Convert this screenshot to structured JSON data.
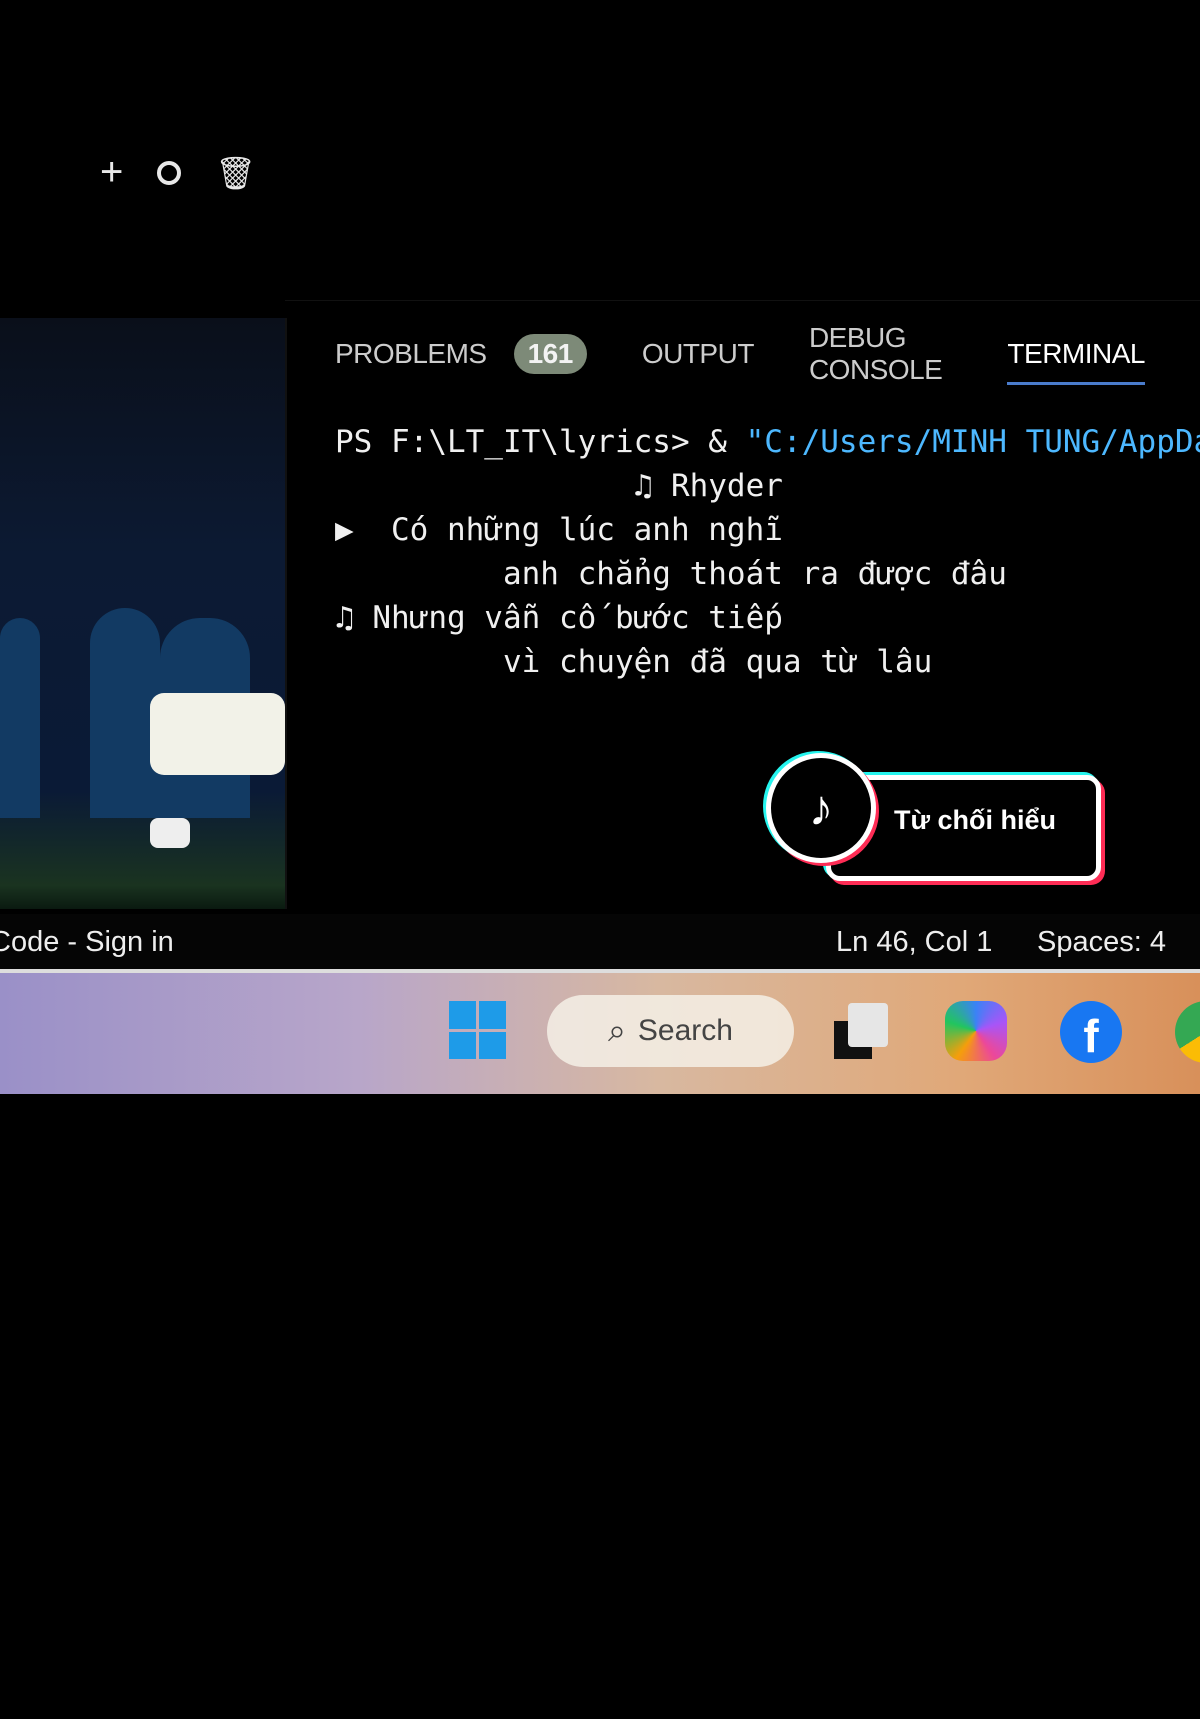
{
  "toolbar": {
    "icons": [
      "plus-icon",
      "circle-icon",
      "trash-icon"
    ]
  },
  "panel": {
    "tabs": [
      {
        "label": "PROBLEMS",
        "count": "161"
      },
      {
        "label": "OUTPUT"
      },
      {
        "label": "DEBUG CONSOLE"
      },
      {
        "label": "TERMINAL",
        "active": true
      }
    ],
    "accent": "#4a7ccc"
  },
  "terminal": {
    "prompt": "PS F:\\LT_IT\\lyrics> & ",
    "command": "\"C:/Users/MINH TUNG/AppDa",
    "lines": [
      "                ♫ Rhyder",
      "▶  Có những lúc anh nghĩ",
      "         anh chẳng thoát ra được đâu",
      "♫ Nhưng vẫn cố bước tiếp",
      "         vì chuyện đã qua từ lâu"
    ]
  },
  "statusbar": {
    "left": "Code - Sign in",
    "position": "Ln 46, Col 1",
    "spaces": "Spaces: 4"
  },
  "taskbar": {
    "search_label": "Search"
  },
  "overlay": {
    "caption": "Từ chối hiểu"
  }
}
